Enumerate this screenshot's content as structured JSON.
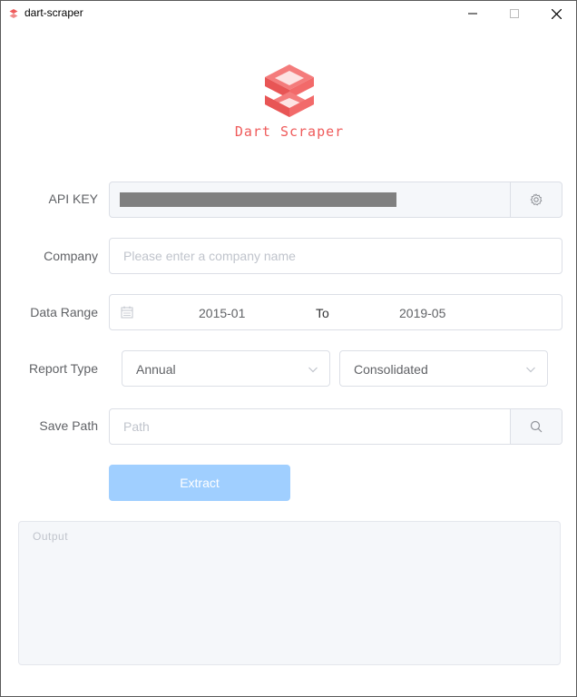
{
  "window": {
    "title": "dart-scraper",
    "controls": {
      "minimize": "minimize-icon",
      "maximize": "maximize-icon",
      "close": "close-icon"
    }
  },
  "brand": {
    "name": "Dart Scraper",
    "color": "#ef5b5b"
  },
  "form": {
    "api_key": {
      "label": "API KEY",
      "action_icon": "gear-icon"
    },
    "company": {
      "label": "Company",
      "placeholder": "Please enter a company name",
      "value": ""
    },
    "date_range": {
      "label": "Data Range",
      "start": "2015-01",
      "separator": "To",
      "end": "2019-05",
      "icon": "calendar-icon"
    },
    "report_type": {
      "label": "Report Type",
      "period": "Annual",
      "scope": "Consolidated"
    },
    "save_path": {
      "label": "Save Path",
      "placeholder": "Path",
      "value": "",
      "action_icon": "search-icon"
    },
    "extract_label": "Extract"
  },
  "output": {
    "placeholder": "Output"
  },
  "colors": {
    "accent_disabled": "#a0cfff",
    "border": "#dcdfe6"
  }
}
